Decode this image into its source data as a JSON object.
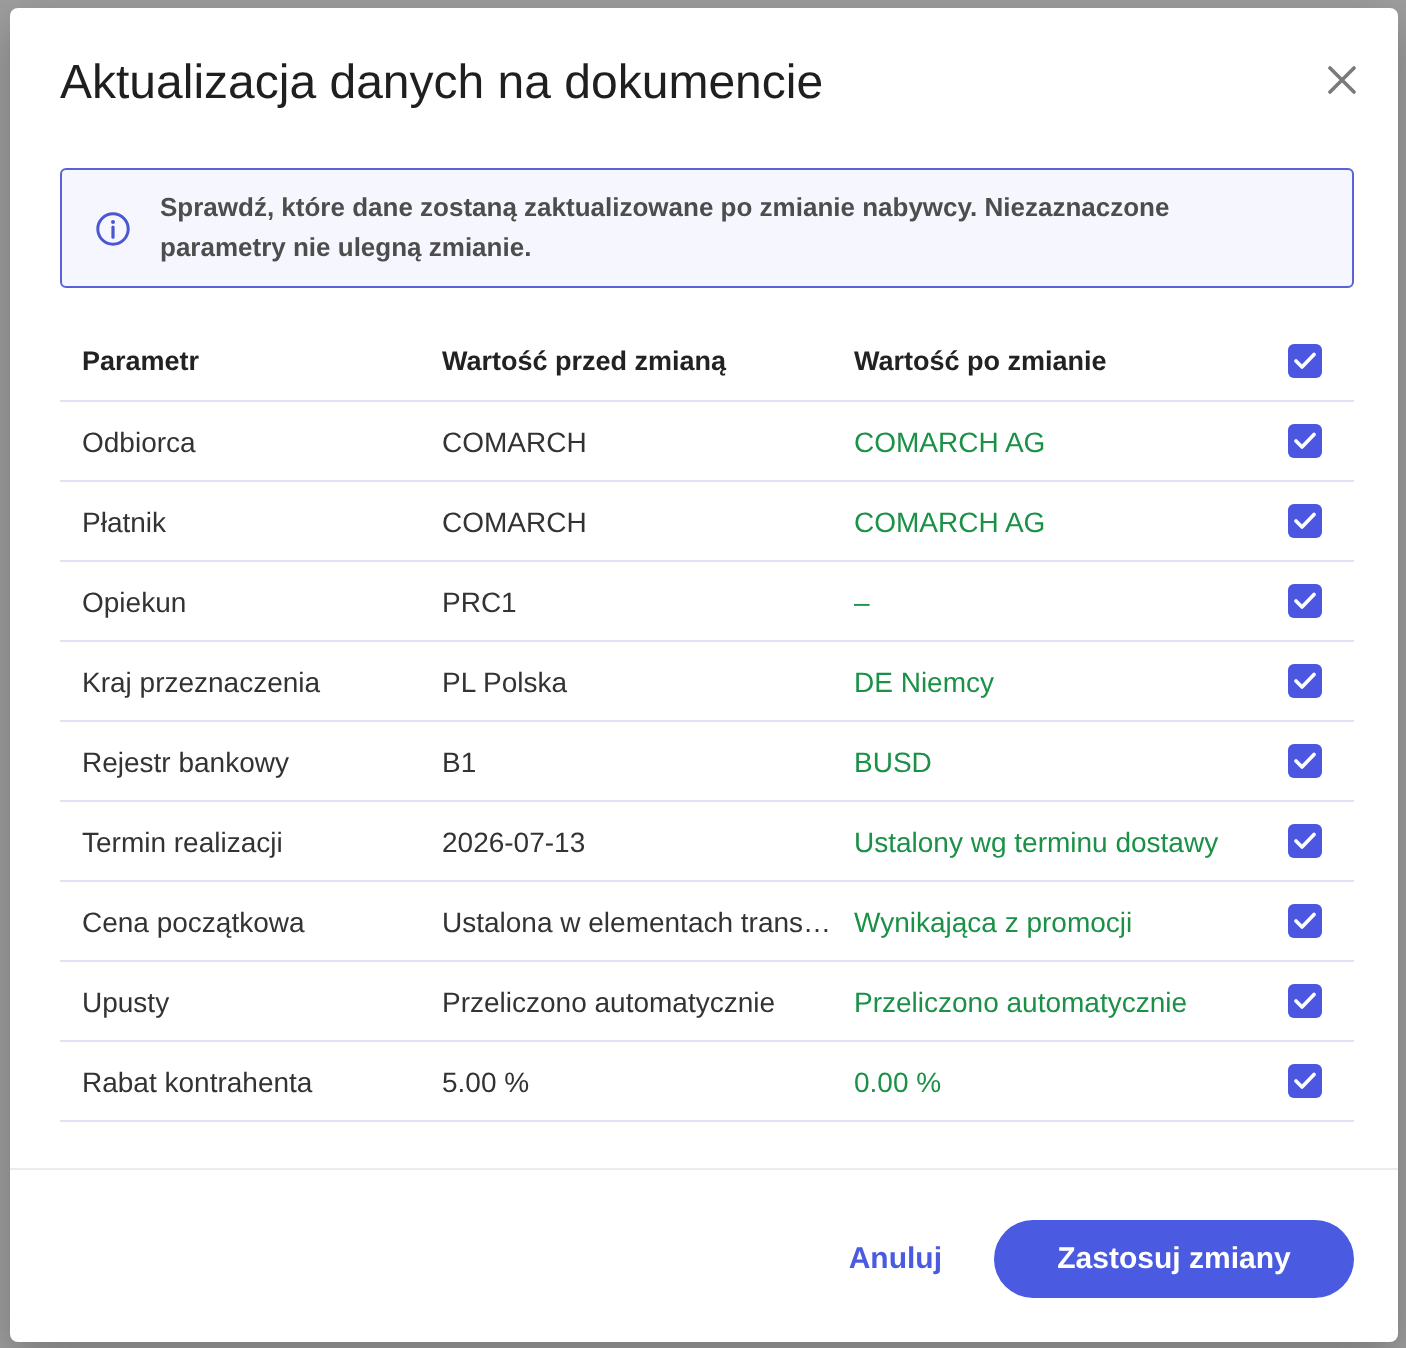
{
  "dialog": {
    "title": "Aktualizacja danych na dokumencie"
  },
  "info": {
    "text": "Sprawdź, które dane zostaną zaktualizowane po zmianie nabywcy. Niezaznaczone parametry nie ulegną zmianie."
  },
  "table": {
    "columns": [
      "Parametr",
      "Wartość przed zmianą",
      "Wartość po zmianie"
    ],
    "select_all": {
      "checked": true
    },
    "rows": [
      {
        "parameter": "Odbiorca",
        "before": "COMARCH",
        "after": "COMARCH AG",
        "checked": true
      },
      {
        "parameter": "Płatnik",
        "before": "COMARCH",
        "after": "COMARCH AG",
        "checked": true
      },
      {
        "parameter": "Opiekun",
        "before": "PRC1",
        "after": "–",
        "checked": true
      },
      {
        "parameter": "Kraj przeznaczenia",
        "before": "PL Polska",
        "after": "DE Niemcy",
        "checked": true
      },
      {
        "parameter": "Rejestr bankowy",
        "before": "B1",
        "after": "BUSD",
        "checked": true
      },
      {
        "parameter": "Termin realizacji",
        "before": "2026-07-13",
        "after": "Ustalony wg terminu dostawy",
        "checked": true
      },
      {
        "parameter": "Cena początkowa",
        "before": "Ustalona w elementach trans…",
        "after": "Wynikająca z promocji",
        "checked": true
      },
      {
        "parameter": "Upusty",
        "before": "Przeliczono automatycznie",
        "after": "Przeliczono automatycznie",
        "checked": true
      },
      {
        "parameter": "Rabat kontrahenta",
        "before": "5.00 %",
        "after": "0.00 %",
        "checked": true
      }
    ]
  },
  "buttons": [
    {
      "label": "Anuluj",
      "kind": "text"
    },
    {
      "label": "Zastosuj zmiany",
      "kind": "primary"
    }
  ]
}
